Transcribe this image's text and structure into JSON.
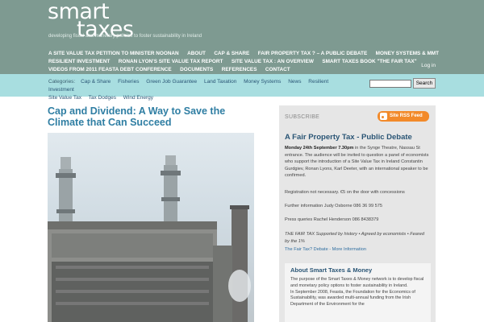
{
  "site": {
    "logo_line1": "smart",
    "logo_line2": "taxes",
    "tagline": "developing fiscal and monetary policies to foster sustainability in Ireland"
  },
  "nav": {
    "row1": [
      "A Site Value Tax Petition to Minister Noonan",
      "About",
      "Cap & Share",
      "Fair Property Tax ? – A Public Debate",
      "Money Systems & MMT"
    ],
    "row2": [
      "Resilient Investment",
      "Ronan Lyon's Site Value Tax Report",
      "Site Value Tax : An Overview",
      "Smart Taxes Book \"The Fair Tax\""
    ],
    "row3": [
      "Videos from 2011 Feasta Debt Conference",
      "Documents",
      "References",
      "Contact"
    ],
    "login": "Log in"
  },
  "categories": {
    "label": "Categories:",
    "row1": [
      "Cap & Share",
      "Fisheries",
      "Green Job Guarantee",
      "Land Taxation",
      "Money Systems",
      "News",
      "Resilient Investment"
    ],
    "row2": [
      "Site Value Tax",
      "Tax Dodges",
      "Wind Energy"
    ]
  },
  "search": {
    "button": "Search",
    "placeholder": ""
  },
  "post": {
    "title": "Cap and Dividend: A Way to Save the Climate that Can Succeed"
  },
  "sidebar": {
    "subscribe": "SUBSCRIBE",
    "rss": "Site RSS Feed",
    "heading": "A Fair Property Tax - Public Debate",
    "p1_bold": "Monday 24th September 7.30pm",
    "p1_rest": " in the Synge Theatre, Nassau St entrance. The audience will be invited to question a panel of economists who support the introduction of a Site Value Tax in Ireland Constantin Gurdgiev, Ronan Lyons, Karl Deeter, with an international speaker to be confirmed.",
    "p2": "Registration not necessary. €5 on the door with concessions",
    "p3": "Further information Judy Osborne 086 36 99 575",
    "p4": "Press queries Rachel Henderson 086 8438379",
    "p5": "THE FAIR TAX Supported by history • Agreed by economists • Feared by the 1%",
    "p5_link": "The Fair Tax? Debate - More Information",
    "about_title": "About Smart Taxes & Money",
    "about_p1": "The purpose of the Smart Taxes & Money network is to develop fiscal and monetary policy options to foster sustainability in Ireland.",
    "about_p2": "In September 2008, Feasta, the Foundation for the Economics of Sustainability, was awarded multi-annual funding from the Irish Department of the Environment for the"
  },
  "colors": {
    "header_bg": "#7e9a91",
    "catbar_bg": "#a8dee0",
    "title": "#2f7ea3",
    "rss": "#f28a2a"
  }
}
